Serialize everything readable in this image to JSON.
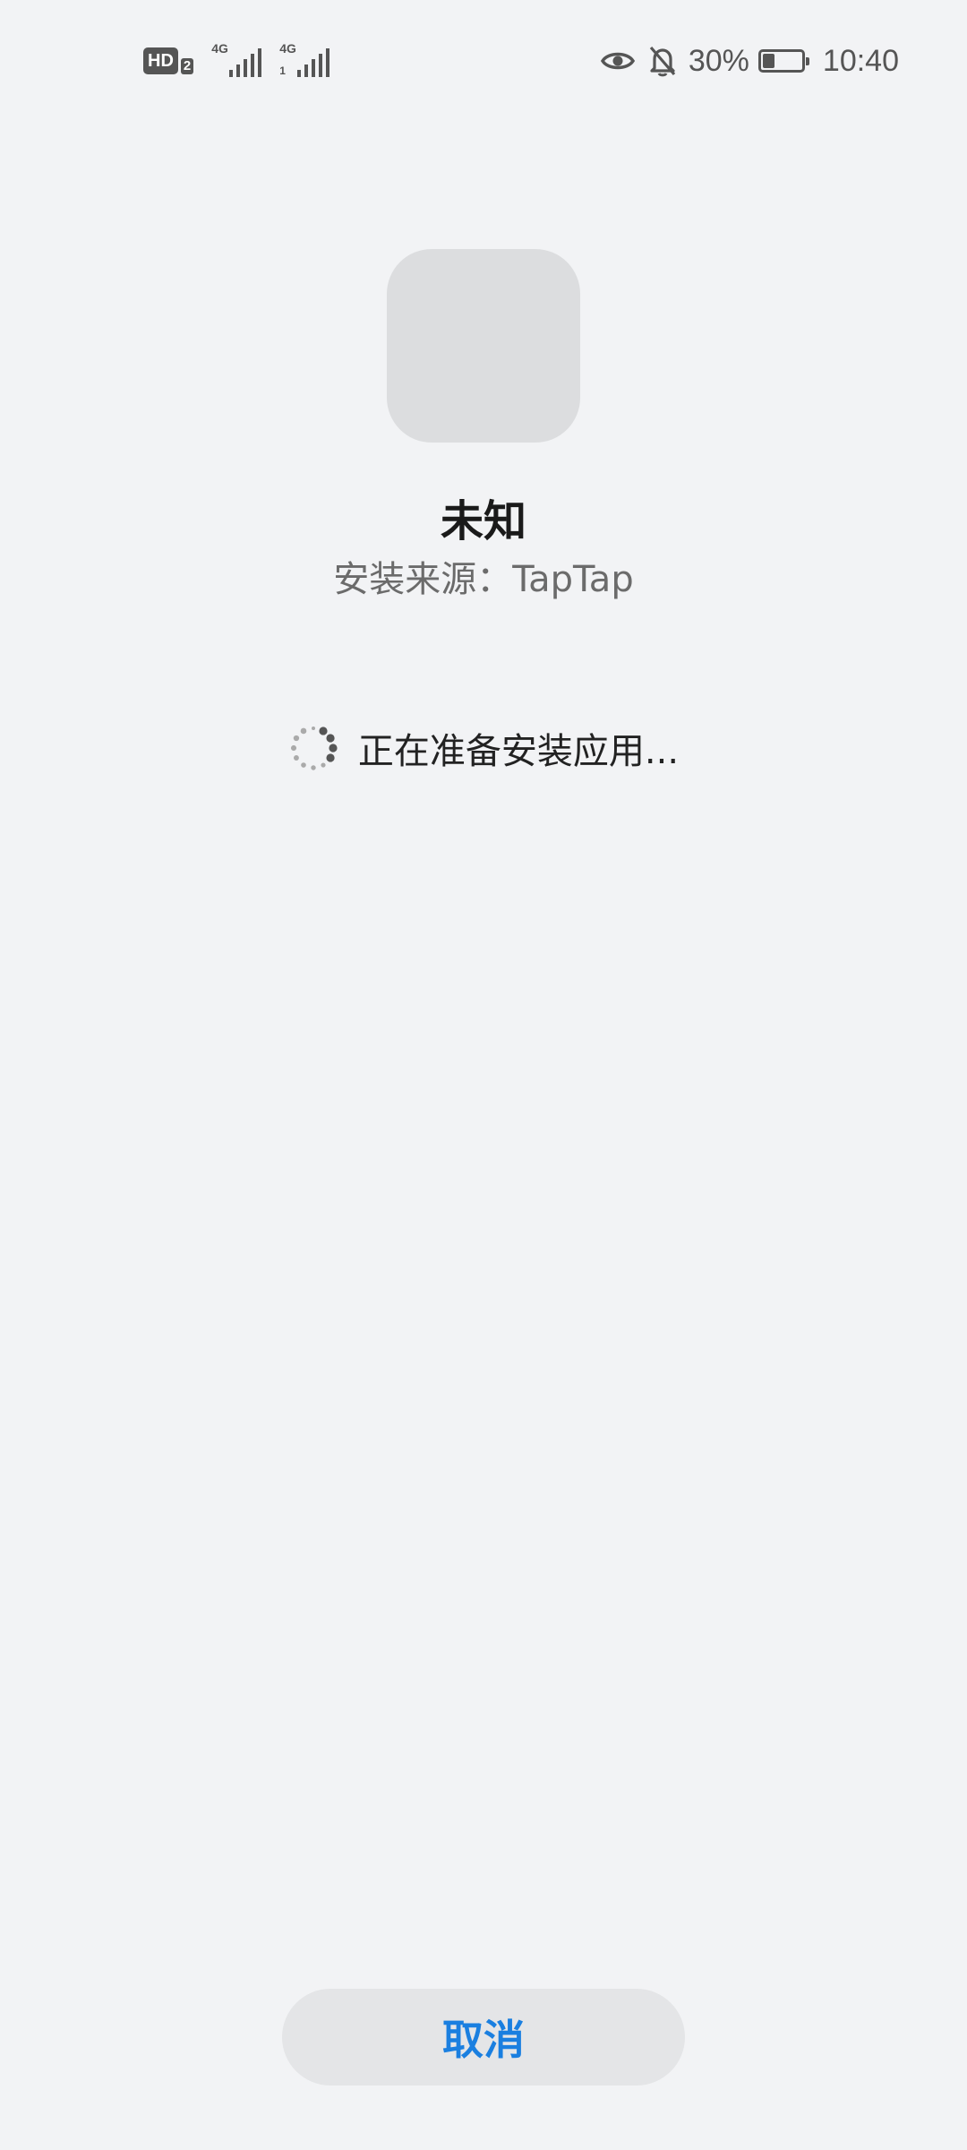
{
  "status_bar": {
    "hd_label": "HD",
    "hd_sim": "2",
    "signal1_label": "4G",
    "signal2_label": "4G",
    "signal2_sub": "1",
    "battery_percent": "30%",
    "battery_level": 0.3,
    "time": "10:40"
  },
  "app": {
    "name": "未知",
    "install_source": "安装来源：TapTap"
  },
  "loading": {
    "text": "正在准备安装应用..."
  },
  "actions": {
    "cancel_label": "取消"
  },
  "colors": {
    "background": "#f2f3f5",
    "accent": "#1a7fe0",
    "icon_placeholder": "#dcdddf"
  }
}
